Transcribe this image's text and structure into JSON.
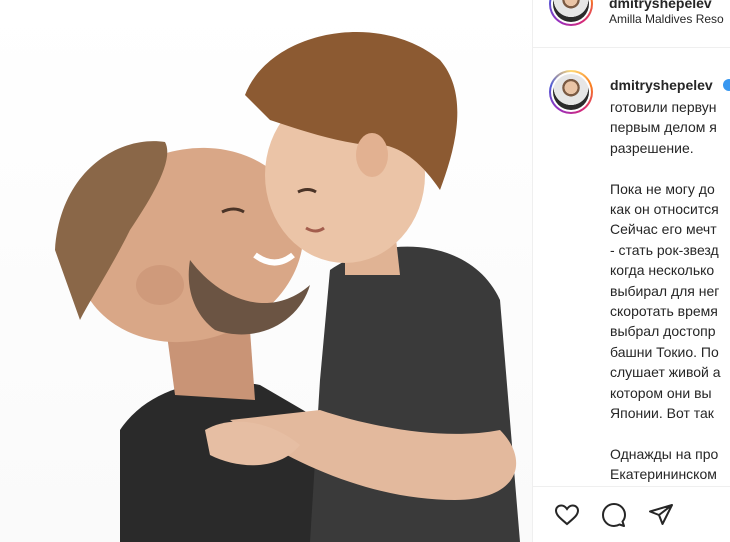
{
  "post": {
    "author_username": "dmitryshepelev",
    "location": "Amilla Maldives Reso",
    "caption_username": "dmitryshepelev",
    "caption_lines": [
      "готовили первун",
      "первым делом я",
      "разрешение.",
      "",
      "Пока не могу до",
      "как он относится",
      "Сейчас его мечт",
      "- стать рок-звезд",
      "когда несколько",
      "выбирал для нег",
      "скоротать время",
      "выбрал достопр",
      "башни Токио. По",
      "слушает живой а",
      "котором они вы",
      "Японии. Вот так",
      "",
      "Однажды на про",
      "Екатерининском"
    ]
  },
  "icons": {
    "like": "heart-icon",
    "comment": "comment-icon",
    "share": "paper-plane-icon",
    "verified": "verified-badge-icon"
  },
  "colors": {
    "text": "#262626",
    "border": "#efefef",
    "verified": "#3897f0"
  }
}
